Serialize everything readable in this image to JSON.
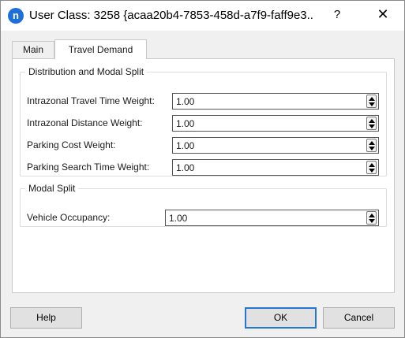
{
  "window": {
    "title": "User Class: 3258  {acaa20b4-7853-458d-a7f9-faff9e3...",
    "app_icon_letter": "n",
    "help_glyph": "?",
    "close_glyph": "✕"
  },
  "tabs": [
    {
      "label": "Main",
      "active": false
    },
    {
      "label": "Travel Demand",
      "active": true
    }
  ],
  "distribution": {
    "title": "Distribution and Modal Split",
    "fields": [
      {
        "label": "Intrazonal Travel Time Weight:",
        "value": "1.00"
      },
      {
        "label": "Intrazonal Distance Weight:",
        "value": "1.00"
      },
      {
        "label": "Parking Cost Weight:",
        "value": "1.00"
      },
      {
        "label": "Parking Search Time Weight:",
        "value": "1.00"
      }
    ]
  },
  "modal_split": {
    "title": "Modal Split",
    "fields": [
      {
        "label": "Vehicle Occupancy:",
        "value": "1.00"
      }
    ]
  },
  "buttons": {
    "help": "Help",
    "ok": "OK",
    "cancel": "Cancel"
  },
  "colors": {
    "accent": "#2677d3",
    "app_icon": "#1e6fd9",
    "dialog_bg": "#f0f0f0"
  }
}
